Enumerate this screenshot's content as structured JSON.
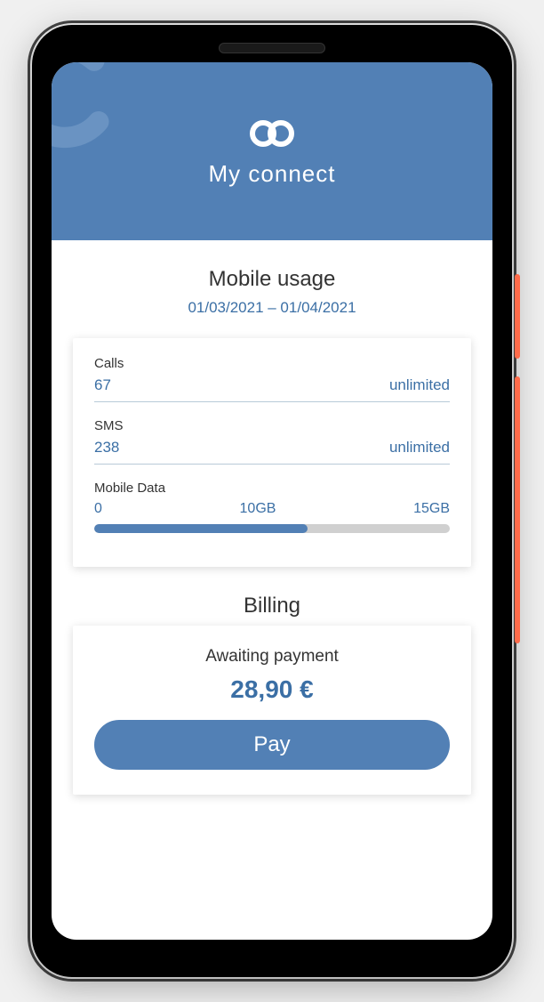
{
  "header": {
    "app_title": "My connect"
  },
  "usage": {
    "section_title": "Mobile usage",
    "date_range": "01/03/2021 – 01/04/2021",
    "rows": [
      {
        "label": "Calls",
        "used": "67",
        "limit": "unlimited"
      },
      {
        "label": "SMS",
        "used": "238",
        "limit": "unlimited"
      }
    ],
    "data": {
      "label": "Mobile Data",
      "start": "0",
      "mid": "10GB",
      "end": "15GB",
      "progress_percent": 60
    }
  },
  "billing": {
    "section_title": "Billing",
    "status": "Awaiting payment",
    "amount": "28,90 €",
    "pay_button": "Pay"
  },
  "colors": {
    "primary": "#5280b5",
    "accent": "#3b6fa5",
    "side": "#ff6b4a"
  }
}
